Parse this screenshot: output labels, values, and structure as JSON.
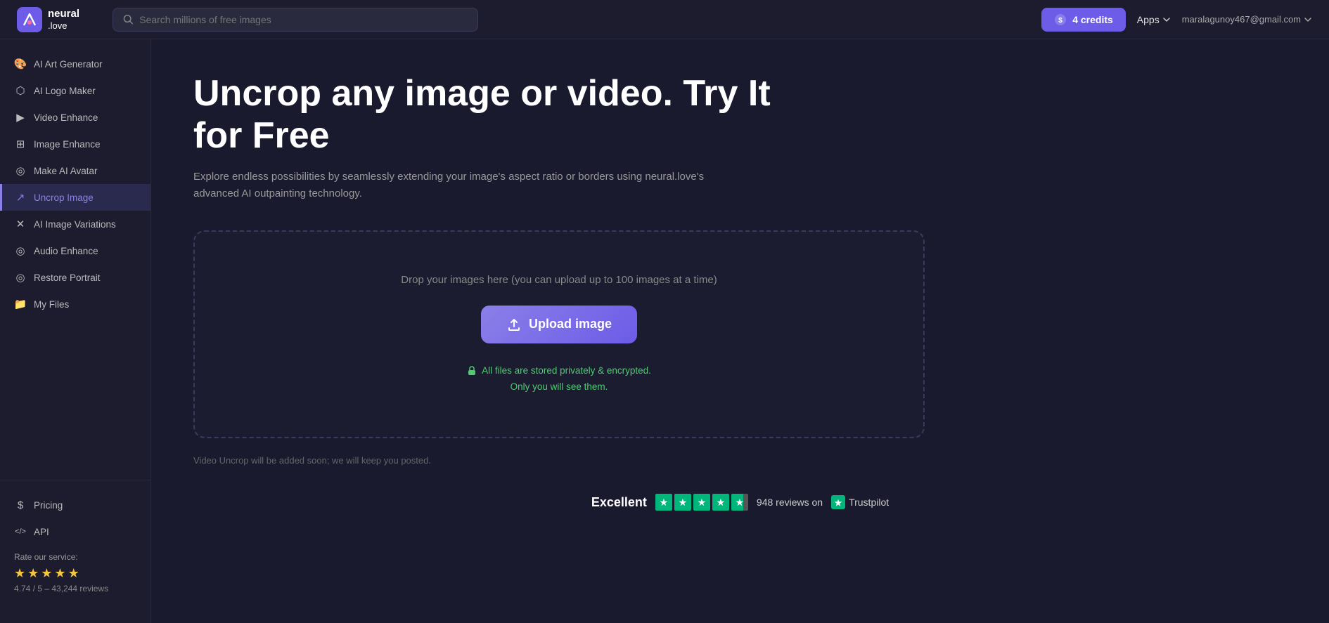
{
  "header": {
    "logo_name": "neural",
    "logo_domain": ".love",
    "search_placeholder": "Search millions of free images",
    "credits_label": "4 credits",
    "apps_label": "Apps",
    "user_email": "maralagunoy467@gmail.com"
  },
  "sidebar": {
    "items": [
      {
        "id": "ai-art-generator",
        "label": "AI Art Generator",
        "icon": "🎨"
      },
      {
        "id": "ai-logo-maker",
        "label": "AI Logo Maker",
        "icon": "⬡"
      },
      {
        "id": "video-enhance",
        "label": "Video Enhance",
        "icon": "▶"
      },
      {
        "id": "image-enhance",
        "label": "Image Enhance",
        "icon": "⊞"
      },
      {
        "id": "make-ai-avatar",
        "label": "Make AI Avatar",
        "icon": "◎"
      },
      {
        "id": "uncrop-image",
        "label": "Uncrop Image",
        "icon": "↗",
        "active": true
      },
      {
        "id": "ai-image-variations",
        "label": "AI Image Variations",
        "icon": "✕"
      },
      {
        "id": "audio-enhance",
        "label": "Audio Enhance",
        "icon": "◎"
      },
      {
        "id": "restore-portrait",
        "label": "Restore Portrait",
        "icon": "◎"
      },
      {
        "id": "my-files",
        "label": "My Files",
        "icon": "📁"
      }
    ],
    "bottom_items": [
      {
        "id": "pricing",
        "label": "Pricing",
        "icon": "$"
      },
      {
        "id": "api",
        "label": "API",
        "icon": "</>"
      }
    ],
    "rate_label": "Rate our service:",
    "rating_score": "4.74",
    "rating_max": "5",
    "rating_count": "43,244",
    "rating_text": "4.74 / 5 – 43,244 reviews"
  },
  "main": {
    "title": "Uncrop any image or video. Try It for Free",
    "description": "Explore endless possibilities by seamlessly extending your image's aspect ratio or borders using neural.love's advanced AI outpainting technology.",
    "drop_text": "Drop your images here (you can upload up to 100 images at a time)",
    "upload_button": "Upload image",
    "privacy_line1": "All files are stored privately & encrypted.",
    "privacy_line2": "Only you will see them.",
    "video_note": "Video Uncrop will be added soon; we will keep you posted.",
    "trustpilot": {
      "excellent": "Excellent",
      "reviews_count": "948 reviews on",
      "platform": "Trustpilot"
    }
  }
}
